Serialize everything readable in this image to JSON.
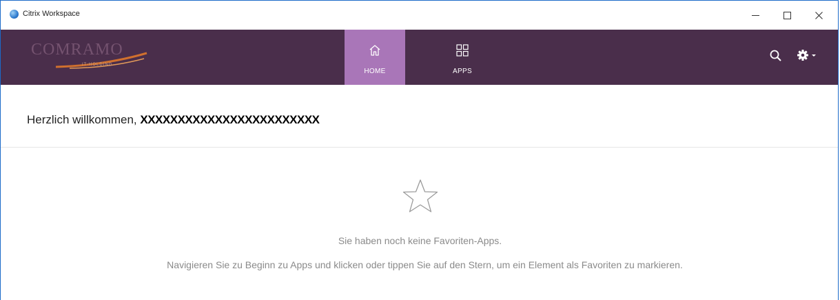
{
  "window": {
    "title": "Citrix Workspace",
    "controls": [
      "minimize",
      "maximize",
      "close"
    ]
  },
  "navbar": {
    "logo_text": "COMRAMO",
    "logo_subtext": "IT-HOLDING",
    "tabs": [
      {
        "label": "HOME",
        "icon": "home-icon",
        "active": true
      },
      {
        "label": "APPS",
        "icon": "apps-grid-icon",
        "active": false
      }
    ],
    "search_icon": "search-icon",
    "settings_icon": "gear-icon"
  },
  "welcome": {
    "greeting": "Herzlich willkommen,",
    "username": "XXXXXXXXXXXXXXXXXXXXXXXX"
  },
  "favorites": {
    "icon": "star-icon",
    "empty_title": "Sie haben noch keine Favoriten-Apps.",
    "empty_description": "Navigieren Sie zu Beginn zu Apps und klicken oder tippen Sie auf den Stern, um ein Element als Favoriten zu markieren."
  },
  "colors": {
    "navbar": "#4a2e4b",
    "active_tab": "#a976b8",
    "muted_text": "#8a8a8a",
    "window_border": "#1b6ac9"
  }
}
